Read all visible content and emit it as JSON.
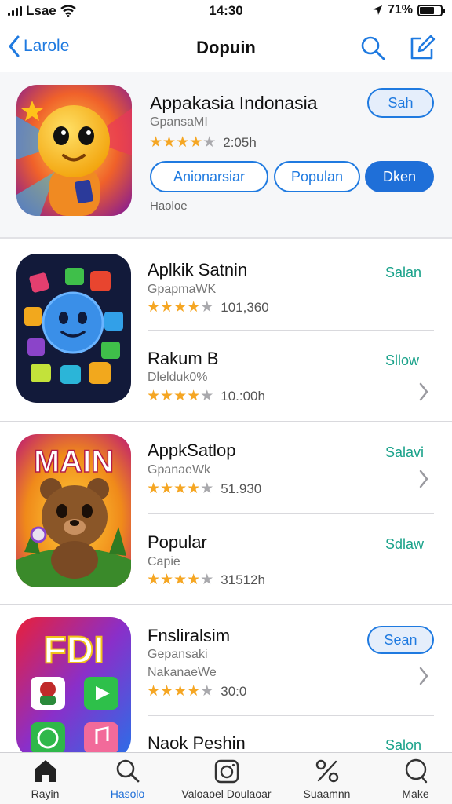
{
  "status_bar": {
    "carrier": "Lsae",
    "time": "14:30",
    "battery_text": "71%",
    "battery_level": 0.71
  },
  "nav": {
    "back_label": "Larole",
    "title": "Dopuin"
  },
  "featured": {
    "name": "Appakasia Indonasia",
    "subtitle": "GpansaMI",
    "rating": 4,
    "rating_text": "2:05h",
    "get_label": "Sah",
    "chips": [
      "Anionarsiar",
      "Populan",
      "Dken"
    ],
    "note": "Haoloe"
  },
  "apps": [
    {
      "name": "Aplkik Satnin",
      "subtitle": "GpapmaWK",
      "rating": 4,
      "rating_text": "101,360",
      "action": "Salan"
    },
    {
      "name": "Rakum      B",
      "subtitle": "Dlelduk0%",
      "rating": 4,
      "rating_text": "10.:00h",
      "action": "Sllow"
    },
    {
      "name": "AppkSatlop",
      "subtitle": "GpanaeWk",
      "rating": 4,
      "rating_text": "51.930",
      "action": "Salavi",
      "icon_text": "MAIN"
    },
    {
      "name": "Popular",
      "subtitle": "Capie",
      "rating": 4,
      "rating_text": "31512h",
      "action": "Sdlaw"
    },
    {
      "name": "Fnsliralsim",
      "subtitle": "Gepansaki",
      "subtitle2": "NakanaeWe",
      "rating": 4,
      "rating_text": "30:0",
      "action": "Sean",
      "icon_text": "FDI"
    },
    {
      "name": "Naok Peshin",
      "action": "Salon"
    }
  ],
  "tabs": [
    {
      "label": "Rayin",
      "icon": "home-icon"
    },
    {
      "label": "Hasolo",
      "icon": "search-icon"
    },
    {
      "label": "Valoaoel Doulaoar",
      "icon": "camera-icon"
    },
    {
      "label": "Suaamnn",
      "icon": "percent-icon"
    },
    {
      "label": "Make",
      "icon": "chat-icon"
    }
  ],
  "colors": {
    "accent": "#1f7ae0",
    "link_green": "#1aa28a",
    "star": "#f5a623"
  }
}
